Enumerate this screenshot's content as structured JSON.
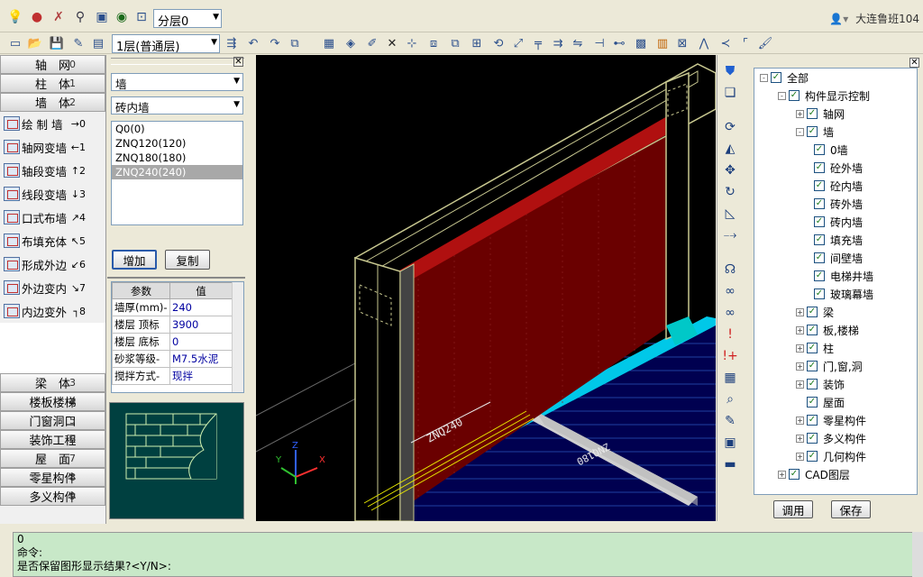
{
  "toolbar1": {
    "layer_dropdown": "分层0",
    "user": "大连鲁班104"
  },
  "toolbar2": {
    "floor_dropdown": "1层(普通层)"
  },
  "left_panel": {
    "categories_top": [
      {
        "label": "轴　网",
        "key": "0"
      },
      {
        "label": "柱　体",
        "key": "1"
      },
      {
        "label": "墙　体",
        "key": "2"
      }
    ],
    "tools": [
      {
        "label": "绘 制 墙",
        "hotkey": "→0"
      },
      {
        "label": "轴网变墙",
        "hotkey": "←1"
      },
      {
        "label": "轴段变墙",
        "hotkey": "↑2"
      },
      {
        "label": "线段变墙",
        "hotkey": "↓3"
      },
      {
        "label": "口式布墙",
        "hotkey": "↗4"
      },
      {
        "label": "布填充体",
        "hotkey": "↖5"
      },
      {
        "label": "形成外边",
        "hotkey": "↙6"
      },
      {
        "label": "外边变内",
        "hotkey": "↘7"
      },
      {
        "label": "内边变外",
        "hotkey": "┐8"
      }
    ],
    "categories_bottom": [
      {
        "label": "梁　体",
        "key": "3"
      },
      {
        "label": "楼板楼梯",
        "key": "4"
      },
      {
        "label": "门窗洞口",
        "key": "5"
      },
      {
        "label": "装饰工程",
        "key": "6"
      },
      {
        "label": "屋　面",
        "key": "7"
      },
      {
        "label": "零星构件",
        "key": "8"
      },
      {
        "label": "多义构件",
        "key": "9"
      }
    ]
  },
  "mid_panel": {
    "type_select": "墙",
    "subtype_select": "砖内墙",
    "list": [
      "Q0(0)",
      "ZNQ120(120)",
      "ZNQ180(180)",
      "ZNQ240(240)"
    ],
    "selected_index": 3,
    "add_button": "增加",
    "copy_button": "复制",
    "param_headers": [
      "参数",
      "值"
    ],
    "params": [
      {
        "name": "墙厚(mm)-",
        "value": "240"
      },
      {
        "name": "楼层 顶标",
        "value": "3900"
      },
      {
        "name": "楼层 底标",
        "value": "0"
      },
      {
        "name": "砂浆等级-",
        "value": "M7.5水泥"
      },
      {
        "name": "搅拌方式-",
        "value": "现拌"
      }
    ]
  },
  "viewport": {
    "wall_label": "ZNQ240",
    "floor_label": "ZNQ180",
    "axis_labels": {
      "x": "X",
      "y": "Y",
      "z": "Z"
    }
  },
  "tree": {
    "root": "全部",
    "group": "构件显示控制",
    "nodes": [
      {
        "label": "轴网",
        "level": 2,
        "expander": "+"
      },
      {
        "label": "墙",
        "level": 2,
        "expander": "-"
      },
      {
        "label": "0墙",
        "level": 3
      },
      {
        "label": "砼外墙",
        "level": 3
      },
      {
        "label": "砼内墙",
        "level": 3
      },
      {
        "label": "砖外墙",
        "level": 3
      },
      {
        "label": "砖内墙",
        "level": 3
      },
      {
        "label": "填充墙",
        "level": 3
      },
      {
        "label": "间壁墙",
        "level": 3
      },
      {
        "label": "电梯井墙",
        "level": 3
      },
      {
        "label": "玻璃幕墙",
        "level": 3
      },
      {
        "label": "梁",
        "level": 2,
        "expander": "+"
      },
      {
        "label": "板,楼梯",
        "level": 2,
        "expander": "+"
      },
      {
        "label": "柱",
        "level": 2,
        "expander": "+"
      },
      {
        "label": "门,窗,洞",
        "level": 2,
        "expander": "+"
      },
      {
        "label": "装饰",
        "level": 2,
        "expander": "+"
      },
      {
        "label": "屋面",
        "level": 2
      },
      {
        "label": "零星构件",
        "level": 2,
        "expander": "+"
      },
      {
        "label": "多义构件",
        "level": 2,
        "expander": "+"
      },
      {
        "label": "几何构件",
        "level": 2,
        "expander": "+"
      }
    ],
    "cad_layer": "CAD图层",
    "apply_button": "调用",
    "save_button": "保存"
  },
  "command": {
    "line1": "0",
    "line2": "命令:",
    "line3": "是否保留图形显示结果?<Y/N>:"
  },
  "colors": {
    "wall_face": "#6a0000",
    "wall_edge": "#c8c890",
    "slab": "#00e8ff",
    "background": "#000000",
    "preview_bg": "#004040"
  }
}
